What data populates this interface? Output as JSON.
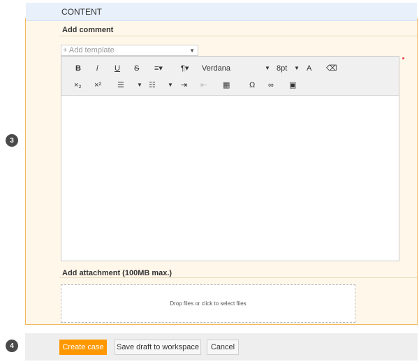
{
  "steps": {
    "content": "3",
    "actions": "4"
  },
  "content_section": {
    "title": "CONTENT"
  },
  "comment": {
    "title": "Add comment",
    "template_placeholder": "+ Add template",
    "required_indicator": "*"
  },
  "editor": {
    "toolbar": {
      "bold": "B",
      "italic": "i",
      "underline": "U",
      "strikethrough": "S",
      "font_family": "Verdana",
      "font_size": "8pt",
      "subscript": "×₂",
      "superscript": "×²",
      "special_char": "Ω"
    },
    "body_text": ""
  },
  "attachment": {
    "title": "Add attachment (100MB max.)",
    "dropzone_text": "Drop files or click to select files"
  },
  "actions": {
    "create_label": "Create case",
    "draft_label": "Save draft to workspace",
    "cancel_label": "Cancel",
    "accent_color": "#ff9800"
  }
}
